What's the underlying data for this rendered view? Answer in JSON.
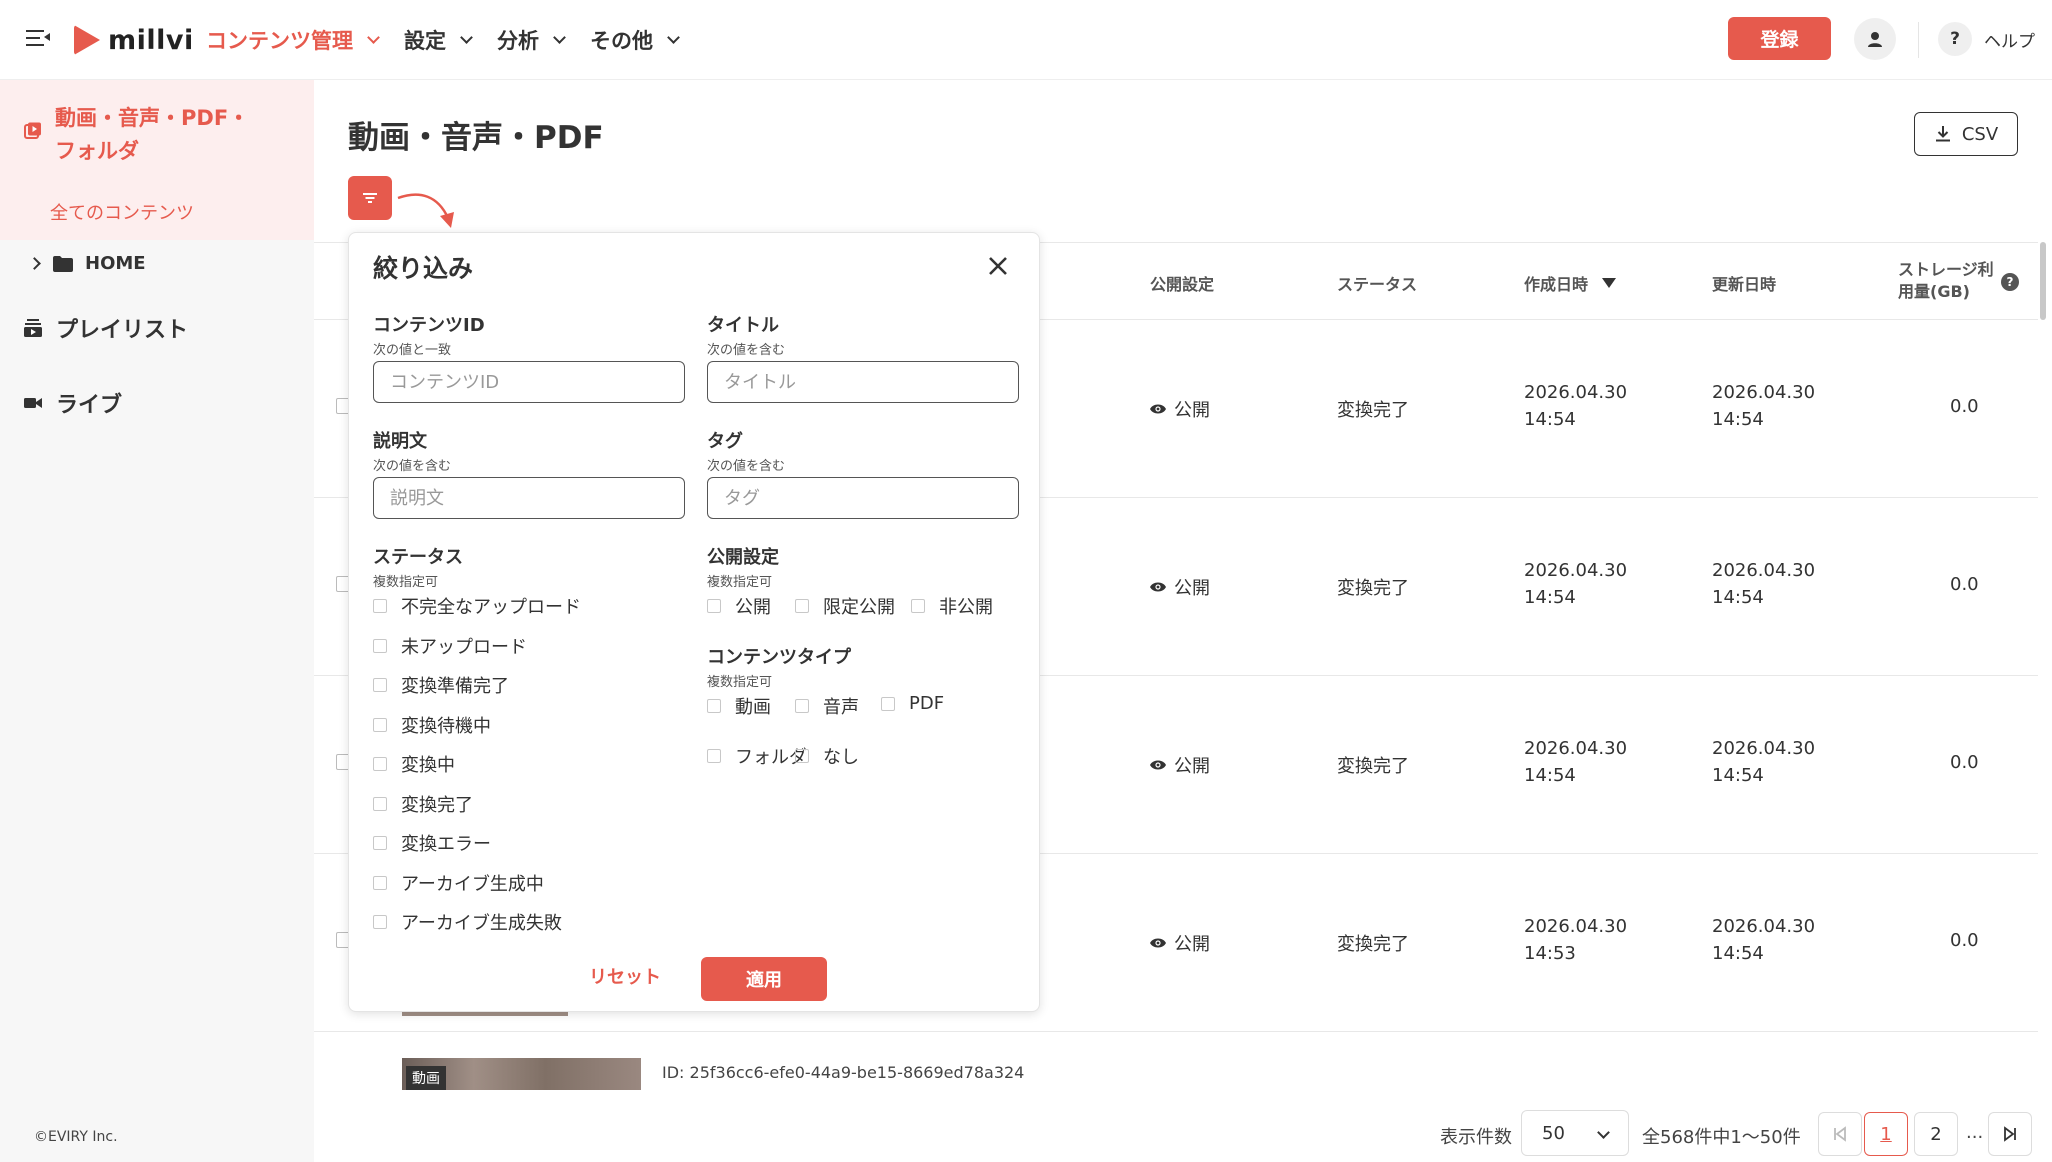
{
  "header": {
    "logo_text": "millvi",
    "nav": [
      "コンテンツ管理",
      "設定",
      "分析",
      "その他"
    ],
    "register_label": "登録",
    "help_label": "ヘルプ",
    "help_symbol": "?"
  },
  "sidebar": {
    "group_label": "動画・音声・PDF・フォルダ",
    "sub_item": "全てのコンテンツ",
    "home_label": "HOME",
    "playlist_label": "プレイリスト",
    "live_label": "ライブ",
    "copyright": "©EVIRY Inc."
  },
  "main": {
    "title": "動画・音声・PDF",
    "csv_label": "CSV"
  },
  "table": {
    "headers": {
      "visibility": "公開設定",
      "status": "ステータス",
      "created": "作成日時",
      "updated": "更新日時",
      "storage": "ストレージ利用量(GB)"
    },
    "rows": [
      {
        "visibility": "公開",
        "status": "変換完了",
        "created_date": "2026.04.30",
        "created_time": "14:54",
        "updated_date": "2026.04.30",
        "updated_time": "14:54",
        "storage": "0.0"
      },
      {
        "visibility": "公開",
        "status": "変換完了",
        "created_date": "2026.04.30",
        "created_time": "14:54",
        "updated_date": "2026.04.30",
        "updated_time": "14:54",
        "storage": "0.0"
      },
      {
        "visibility": "公開",
        "status": "変換完了",
        "created_date": "2026.04.30",
        "created_time": "14:54",
        "updated_date": "2026.04.30",
        "updated_time": "14:54",
        "storage": "0.0"
      },
      {
        "visibility": "公開",
        "status": "変換完了",
        "created_date": "2026.04.30",
        "created_time": "14:53",
        "updated_date": "2026.04.30",
        "updated_time": "14:54",
        "storage": "0.0"
      }
    ],
    "last_row": {
      "badge": "動画",
      "id_text": "ID: 25f36cc6-efe0-44a9-be15-8669ed78a324"
    }
  },
  "pagination": {
    "per_page_label": "表示件数",
    "per_page_value": "50",
    "total_text": "全568件中1〜50件",
    "pages": [
      "1",
      "2"
    ],
    "ellipsis": "..."
  },
  "filter": {
    "title": "絞り込み",
    "content_id": {
      "label": "コンテンツID",
      "hint": "次の値と一致",
      "placeholder": "コンテンツID"
    },
    "title_field": {
      "label": "タイトル",
      "hint": "次の値を含む",
      "placeholder": "タイトル"
    },
    "description": {
      "label": "説明文",
      "hint": "次の値を含む",
      "placeholder": "説明文"
    },
    "tag": {
      "label": "タグ",
      "hint": "次の値を含む",
      "placeholder": "タグ"
    },
    "status": {
      "label": "ステータス",
      "hint": "複数指定可",
      "options": [
        "不完全なアップロード",
        "未アップロード",
        "変換準備完了",
        "変換待機中",
        "変換中",
        "変換完了",
        "変換エラー",
        "アーカイブ生成中",
        "アーカイブ生成失敗"
      ]
    },
    "visibility": {
      "label": "公開設定",
      "hint": "複数指定可",
      "options": [
        "公開",
        "限定公開",
        "非公開"
      ]
    },
    "content_type": {
      "label": "コンテンツタイプ",
      "hint": "複数指定可",
      "options": [
        "動画",
        "音声",
        "PDF",
        "フォルダ",
        "なし"
      ]
    },
    "reset_label": "リセット",
    "apply_label": "適用"
  },
  "colors": {
    "accent": "#e65a4d",
    "accent_light": "#fdeeee"
  }
}
